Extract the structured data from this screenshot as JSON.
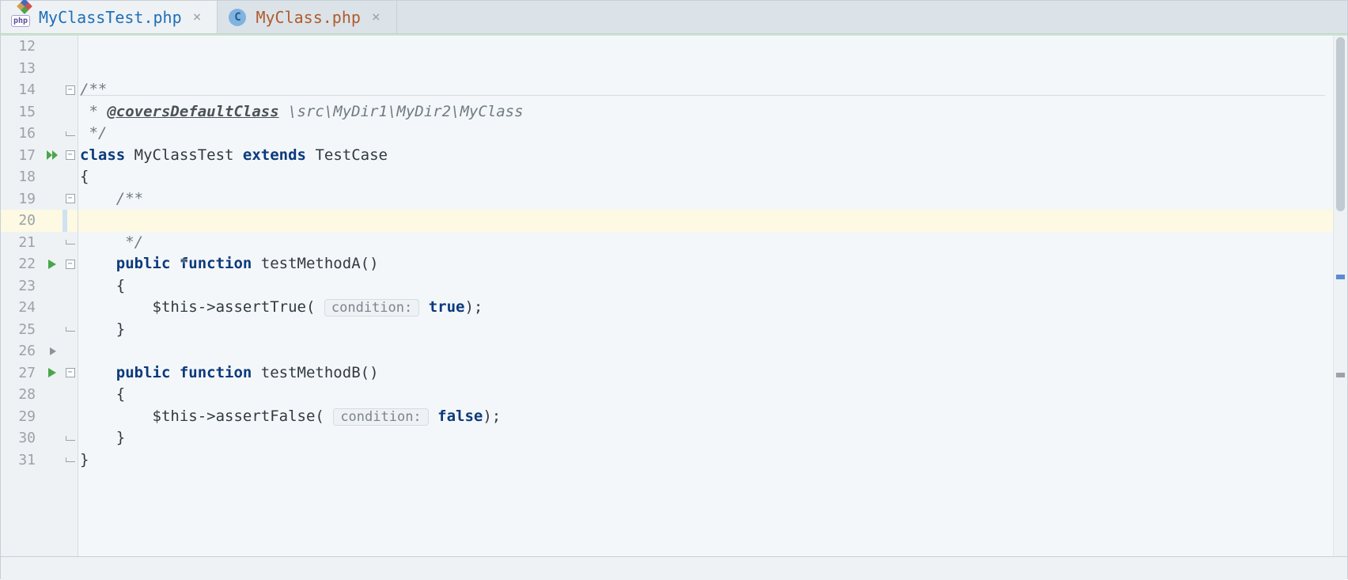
{
  "tabs": [
    {
      "label": "MyClassTest.php",
      "icon_text": "php",
      "active": true
    },
    {
      "label": "MyClass.php",
      "icon_text": "C",
      "active": false
    }
  ],
  "gutter": {
    "start": 12,
    "end": 31,
    "cursor_line": 20,
    "run_markers": {
      "double": [
        17
      ],
      "single": [
        22,
        27
      ]
    },
    "fold_play": [
      26
    ]
  },
  "source": {
    "l12": "",
    "l13": "",
    "l14_open": "/**",
    "l15_star": " * ",
    "l15_tag": "@coversDefaultClass",
    "l15_path": " \\src\\MyDir1\\MyDir2\\MyClass",
    "l16_close": " */",
    "l17_a": "class",
    "l17_b": " MyClassTest ",
    "l17_c": "extends",
    "l17_d": " TestCase",
    "l18": "{",
    "l19": "    /**",
    "l20": "     *",
    "l21": "     */",
    "l22_a": "    ",
    "l22_b": "public function",
    "l22_c": " testMethodA()",
    "l23": "    {",
    "l24_a": "        ",
    "l24_b": "$this",
    "l24_c": "->assertTrue( ",
    "l24_hint": "condition:",
    "l24_d": " ",
    "l24_e": "true",
    "l24_f": ");",
    "l25": "    }",
    "l26": "",
    "l27_a": "    ",
    "l27_b": "public function",
    "l27_c": " testMethodB()",
    "l28": "    {",
    "l29_a": "        ",
    "l29_b": "$this",
    "l29_c": "->assertFalse( ",
    "l29_hint": "condition:",
    "l29_d": " ",
    "l29_e": "false",
    "l29_f": ");",
    "l30": "    }",
    "l31": "}"
  },
  "status": {
    "check": "✓"
  }
}
